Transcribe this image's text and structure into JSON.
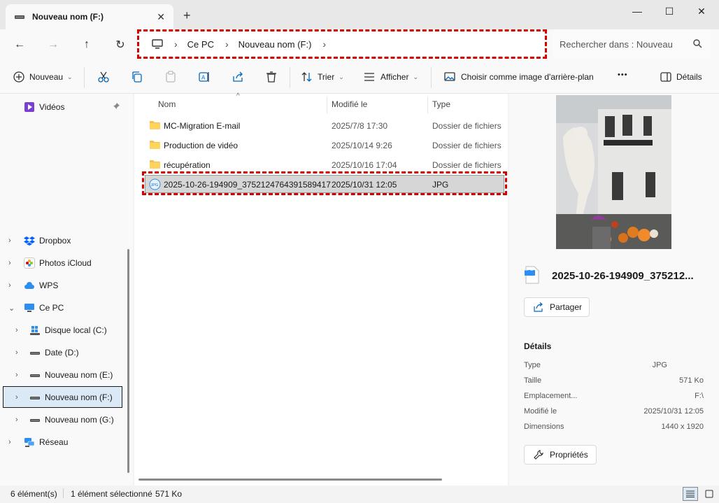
{
  "window": {
    "tab_title": "Nouveau nom (F:)",
    "tab_close": "✕",
    "new_tab": "+",
    "minimize": "—",
    "maximize": "☐",
    "close": "✕"
  },
  "nav": {
    "back": "←",
    "forward": "→",
    "up": "↑",
    "refresh": "↻"
  },
  "address": {
    "breadcrumbs": [
      "Ce PC",
      "Nouveau nom (F:)"
    ],
    "sep": "›"
  },
  "search": {
    "placeholder": "Rechercher dans : Nouveau"
  },
  "toolbar": {
    "new_label": "Nouveau",
    "sort_label": "Trier",
    "view_label": "Afficher",
    "wallpaper_label": "Choisir comme image d'arrière-plan",
    "more_label": "•••",
    "details_label": "Détails"
  },
  "sidebar": {
    "items": [
      {
        "label": "Vidéos"
      },
      {
        "label": "Dropbox"
      },
      {
        "label": "Photos iCloud"
      },
      {
        "label": "WPS"
      },
      {
        "label": "Ce PC"
      },
      {
        "label": "Disque local (C:)"
      },
      {
        "label": "Date (D:)"
      },
      {
        "label": "Nouveau nom (E:)"
      },
      {
        "label": "Nouveau nom (F:)"
      },
      {
        "label": "Nouveau nom (G:)"
      },
      {
        "label": "Réseau"
      }
    ]
  },
  "filelist": {
    "columns": {
      "name": "Nom",
      "modified": "Modifié le",
      "type": "Type"
    },
    "rows": [
      {
        "name": "MC-Migration E-mail",
        "modified": "2025/7/8 17:30",
        "type": "Dossier de fichiers"
      },
      {
        "name": "Production de vidéo",
        "modified": "2025/10/14 9:26",
        "type": "Dossier de fichiers"
      },
      {
        "name": "récupération",
        "modified": "2025/10/16 17:04",
        "type": "Dossier de fichiers"
      },
      {
        "name": "2025-10-26-194909_3752124764391589417",
        "modified": "2025/10/31 12:05",
        "type": "JPG"
      }
    ]
  },
  "details": {
    "filename": "2025-10-26-194909_375212...",
    "file_icon_text": "JPG",
    "share_label": "Partager",
    "section_title": "Détails",
    "props": [
      {
        "label": "Type",
        "value": "JPG"
      },
      {
        "label": "Taille",
        "value": "571 Ko"
      },
      {
        "label": "Emplacement...",
        "value": "F:\\"
      },
      {
        "label": "Modifié le",
        "value": "2025/10/31 12:05"
      },
      {
        "label": "Dimensions",
        "value": "1440 x 1920"
      }
    ],
    "properties_label": "Propriétés"
  },
  "status": {
    "count": "6 élément(s)",
    "selected": "1 élément sélectionné",
    "size": "571 Ko"
  },
  "colors": {
    "accent": "#0067c0",
    "highlight_dash": "#d40000",
    "folder": "#f5c04a",
    "selection_bg": "#d6d6d6"
  }
}
